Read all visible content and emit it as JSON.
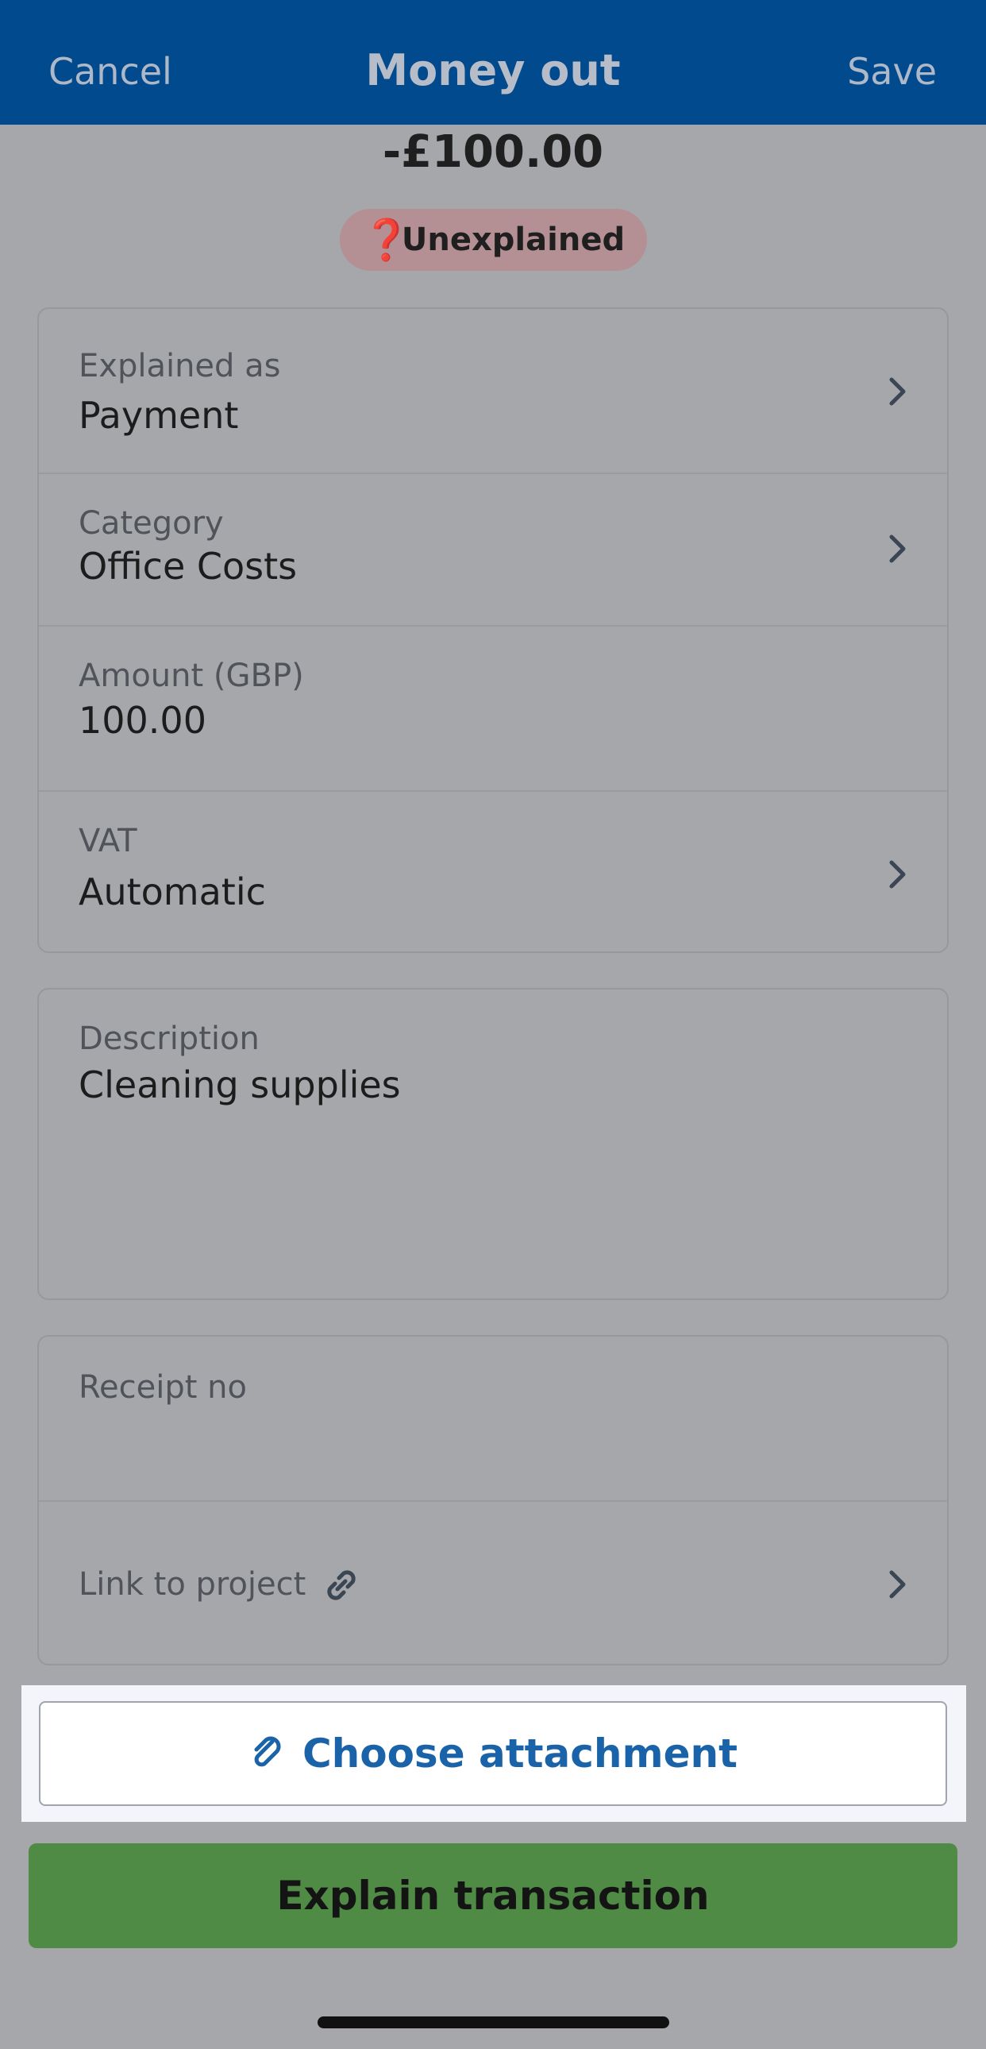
{
  "nav": {
    "cancel_label": "Cancel",
    "title": "Money out",
    "save_label": "Save"
  },
  "transaction": {
    "amount": "-£100.00",
    "status_icon": "❓",
    "status": "Unexplained"
  },
  "details": {
    "explained_as_label": "Explained as",
    "explained_as_value": "Payment",
    "category_label": "Category",
    "category_value": "Office Costs",
    "amount_label": "Amount (GBP)",
    "amount_value": "100.00",
    "vat_label": "VAT",
    "vat_value": "Automatic"
  },
  "description": {
    "label": "Description",
    "value": "Cleaning supplies"
  },
  "extra": {
    "receipt_label": "Receipt no",
    "receipt_value": "",
    "project_label": "Link to project"
  },
  "actions": {
    "attach_label": "Choose attachment",
    "explain_label": "Explain transaction"
  },
  "colors": {
    "nav_bar": "#004a8d",
    "status_pill": "#b48f94",
    "attach_text": "#1a63a8",
    "explain_button": "#4f8b45"
  },
  "icons": [
    "question-icon",
    "chevron-right-icon",
    "link-icon",
    "paperclip-icon"
  ]
}
